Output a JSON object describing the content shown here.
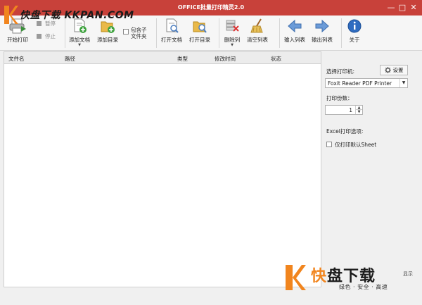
{
  "window": {
    "title": "OFFICE批量打印精灵2.0",
    "minimize_symbol": "—",
    "maximize_symbol": "□",
    "close_symbol": "✕"
  },
  "logo": {
    "text": "快盘下载 KKPAN.COM",
    "icon": "kkpan-logo-icon"
  },
  "toolbar": {
    "start_print": "开始打印",
    "pause": "暂停",
    "stop": "停止",
    "add_docs": "添加文档",
    "add_dir": "添加目录",
    "include_sub_line1": "包含子",
    "include_sub_line2": "文件夹",
    "open_doc": "打开文档",
    "open_dir": "打开目录",
    "delete_col": "删除列",
    "clear_list": "清空列表",
    "import_list": "输入列表",
    "export_list": "输出列表",
    "about": "关于"
  },
  "list": {
    "columns": [
      "文件名",
      "路径",
      "类型",
      "修改时间",
      "状态"
    ],
    "rows": []
  },
  "right_panel": {
    "select_printer_label": "选择打印机:",
    "setup_button": "设置",
    "printer_value": "Foxit Reader PDF Printer",
    "copies_label": "打印份数：",
    "copies_value": "1",
    "excel_options_label": "Excel打印选项:",
    "excel_default_sheet_label": "仅打印默认Sheet",
    "excel_default_sheet_checked": false
  },
  "watermark": {
    "title_first": "快",
    "title_rest": "盘下载",
    "subtitle": "绿色 · 安全 · 高速",
    "extra": "显示"
  },
  "colors": {
    "titlebar": "#c8413a",
    "logo_orange": "#f1851e",
    "toolbar_bg": "#f6f6f6"
  }
}
